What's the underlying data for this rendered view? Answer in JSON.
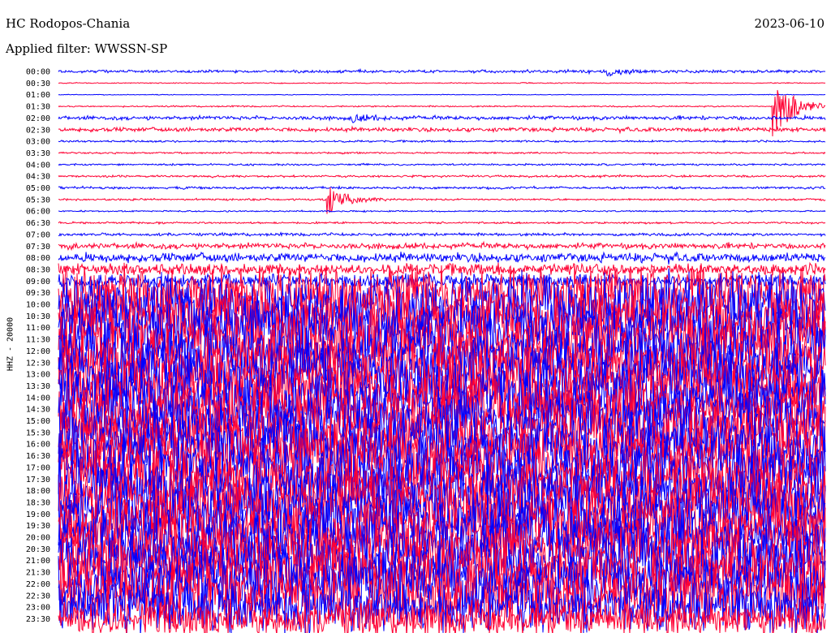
{
  "header": {
    "station": "HC Rodopos-Chania",
    "filter": "Applied filter: WWSSN-SP",
    "date": "2023-06-10",
    "channel": "HHZ - 20000"
  },
  "colors": {
    "trace_a": "#0000ff",
    "trace_b": "#ff0033",
    "background": "#ffffff"
  },
  "chart_data": {
    "type": "line",
    "title": "HC Rodopos-Chania",
    "subtitle": "Applied filter: WWSSN-SP",
    "ylabel": "HHZ - 20000",
    "row_labels": [
      "00:00",
      "00:30",
      "01:00",
      "01:30",
      "02:00",
      "02:30",
      "03:00",
      "03:30",
      "04:00",
      "04:30",
      "05:00",
      "05:30",
      "06:00",
      "06:30",
      "07:00",
      "07:30",
      "08:00",
      "08:30",
      "09:00",
      "09:30",
      "10:00",
      "10:30",
      "11:00",
      "11:30",
      "12:00",
      "12:30",
      "13:00",
      "13:30",
      "14:00",
      "14:30",
      "15:00",
      "15:30",
      "16:00",
      "16:30",
      "17:00",
      "17:30",
      "18:00",
      "18:30",
      "19:00",
      "19:30",
      "20:00",
      "20:30",
      "21:00",
      "21:30",
      "22:00",
      "22:30",
      "23:00",
      "23:30"
    ],
    "row_minutes": 30,
    "x_range_minutes": [
      0,
      30
    ],
    "colors_alternate": [
      "#0000ff",
      "#ff0033"
    ],
    "row_amplitude_relative": [
      0.6,
      0.2,
      0.15,
      0.3,
      0.8,
      0.9,
      0.4,
      0.35,
      0.4,
      0.45,
      0.5,
      0.4,
      0.3,
      0.4,
      0.6,
      1.2,
      2.0,
      2.5,
      3.0,
      12,
      14,
      14,
      14,
      14,
      14,
      14,
      14,
      14,
      14,
      14,
      14,
      14,
      14,
      14,
      14,
      14,
      14,
      14,
      14,
      14,
      14,
      14,
      14,
      14,
      14,
      14,
      12,
      8
    ],
    "events": [
      {
        "row": "00:00",
        "minute": 21.5,
        "amplitude": 2.5
      },
      {
        "row": "01:30",
        "minute": 28.0,
        "amplitude": 18
      },
      {
        "row": "02:00",
        "minute": 11.5,
        "amplitude": 2.0
      },
      {
        "row": "05:30",
        "minute": 10.5,
        "amplitude": 9
      }
    ]
  }
}
